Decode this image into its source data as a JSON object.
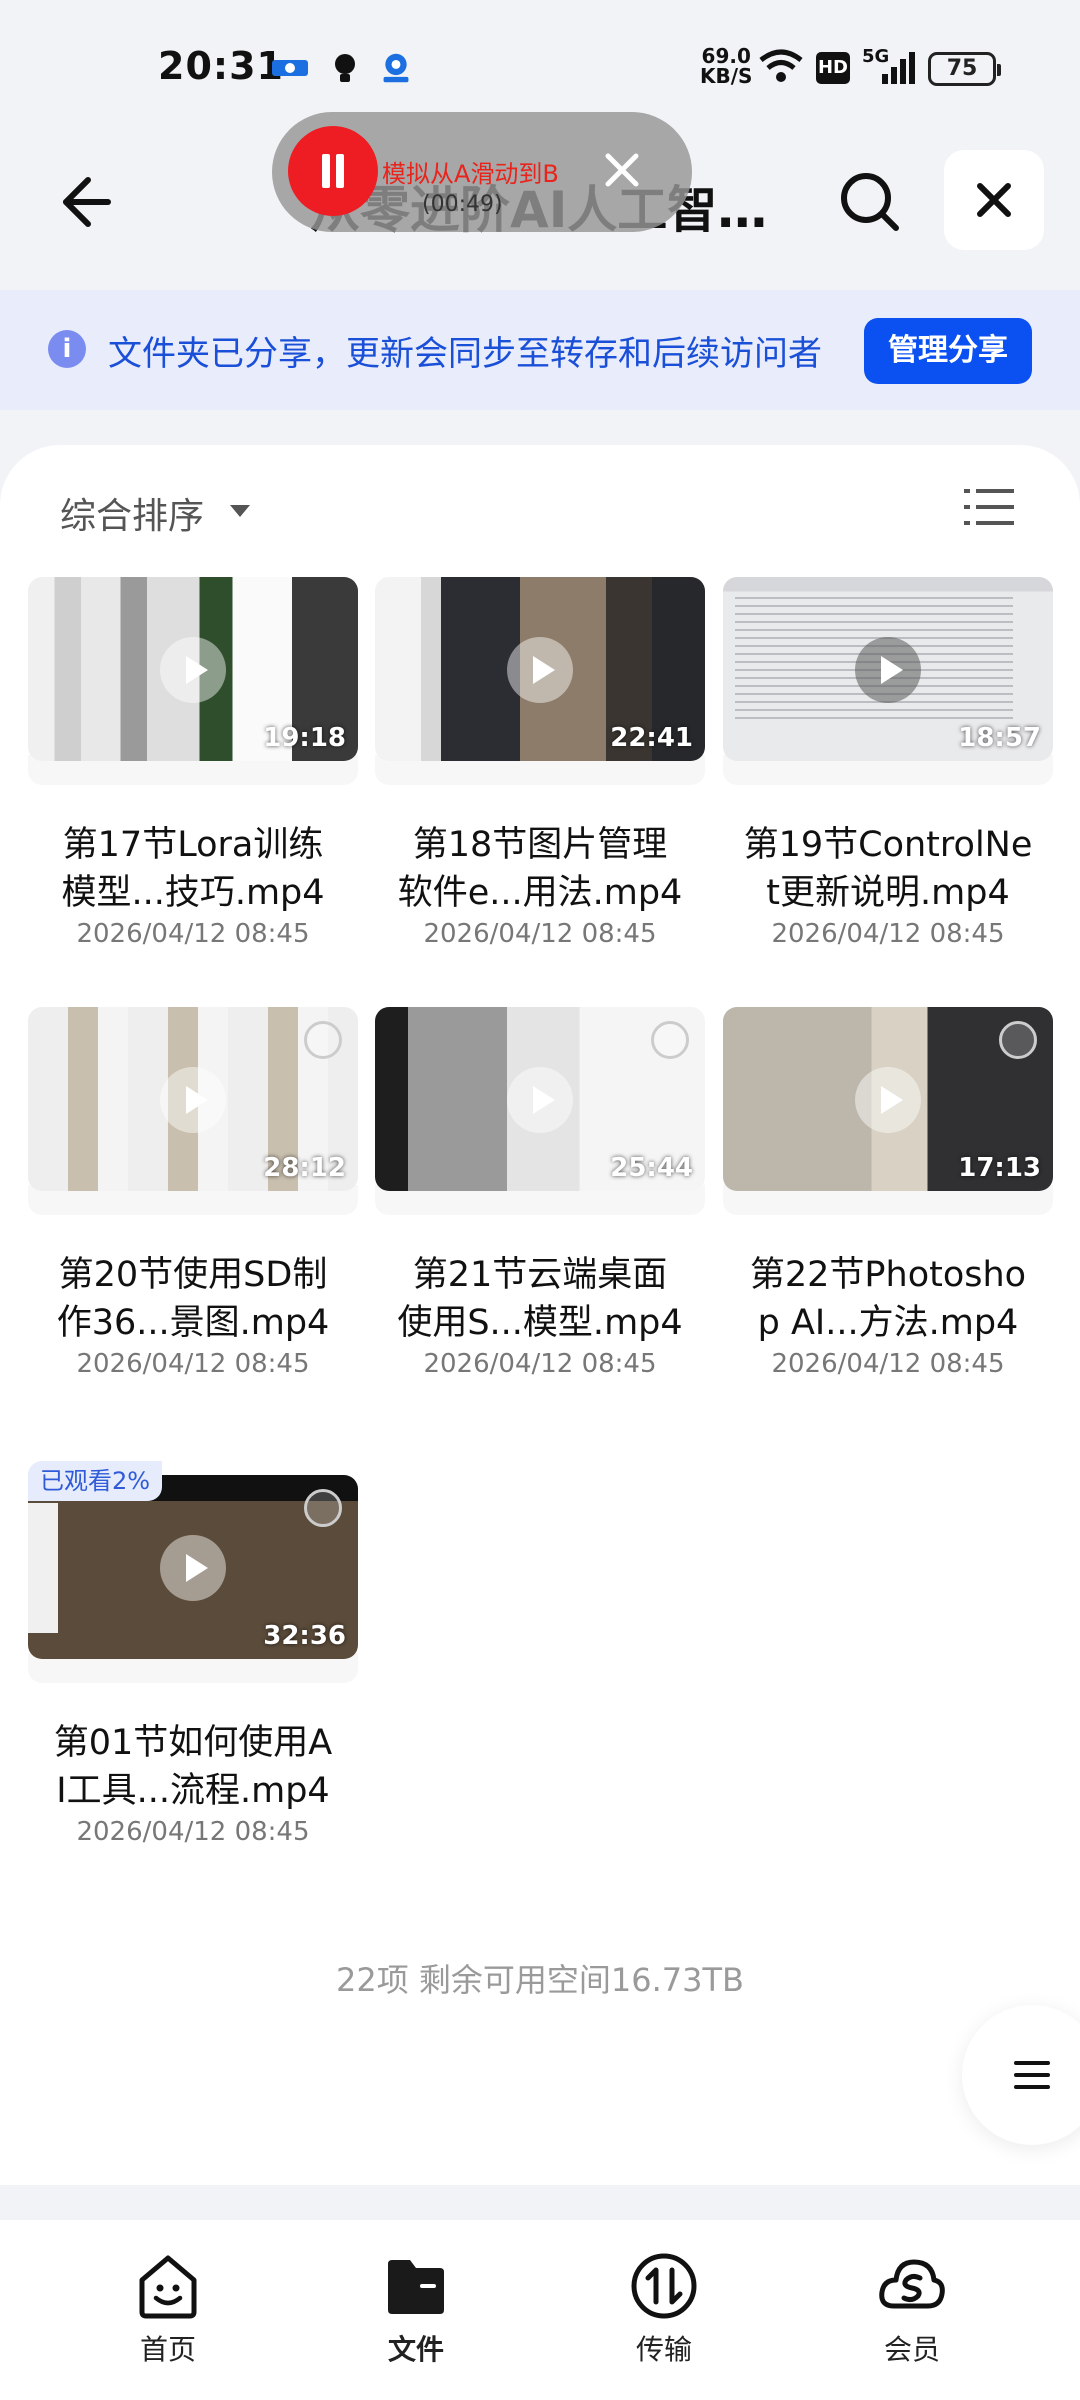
{
  "status_bar": {
    "time": "20:31",
    "speed_value": "69.0",
    "speed_unit": "KB/S",
    "network": "5G",
    "hd": "HD",
    "battery": "75"
  },
  "header": {
    "title": "从零进阶AI人工智…"
  },
  "recorder": {
    "label": "模拟从A滑动到B",
    "elapsed": "(00:49)"
  },
  "banner": {
    "text": "文件夹已分享，更新会同步至转存和后续访问者",
    "button": "管理分享"
  },
  "toolbar": {
    "sort_label": "综合排序"
  },
  "files": [
    {
      "name_line1": "第17节Lora训练",
      "name_line2": "模型...技巧.mp4",
      "date": "2026/04/12 08:45",
      "duration": "19:18"
    },
    {
      "name_line1": "第18节图片管理",
      "name_line2": "软件e...用法.mp4",
      "date": "2026/04/12 08:45",
      "duration": "22:41"
    },
    {
      "name_line1": "第19节ControlNe",
      "name_line2": "t更新说明.mp4",
      "date": "2026/04/12 08:45",
      "duration": "18:57"
    },
    {
      "name_line1": "第20节使用SD制",
      "name_line2": "作36...景图.mp4",
      "date": "2026/04/12 08:45",
      "duration": "28:12"
    },
    {
      "name_line1": "第21节云端桌面",
      "name_line2": "使用S...模型.mp4",
      "date": "2026/04/12 08:45",
      "duration": "25:44"
    },
    {
      "name_line1": "第22节Photosho",
      "name_line2": "p AI...方法.mp4",
      "date": "2026/04/12 08:45",
      "duration": "17:13"
    },
    {
      "name_line1": "第01节如何使用A",
      "name_line2": "I工具...流程.mp4",
      "date": "2026/04/12 08:45",
      "duration": "32:36",
      "badge": "已观看2%"
    }
  ],
  "footer": {
    "count_text": "22项 剩余可用空间16.73TB"
  },
  "bottom_nav": [
    {
      "label": "首页",
      "icon": "home-smile-icon"
    },
    {
      "label": "文件",
      "icon": "folder-icon"
    },
    {
      "label": "传输",
      "icon": "transfer-icon"
    },
    {
      "label": "会员",
      "icon": "cloud-vip-icon"
    }
  ]
}
